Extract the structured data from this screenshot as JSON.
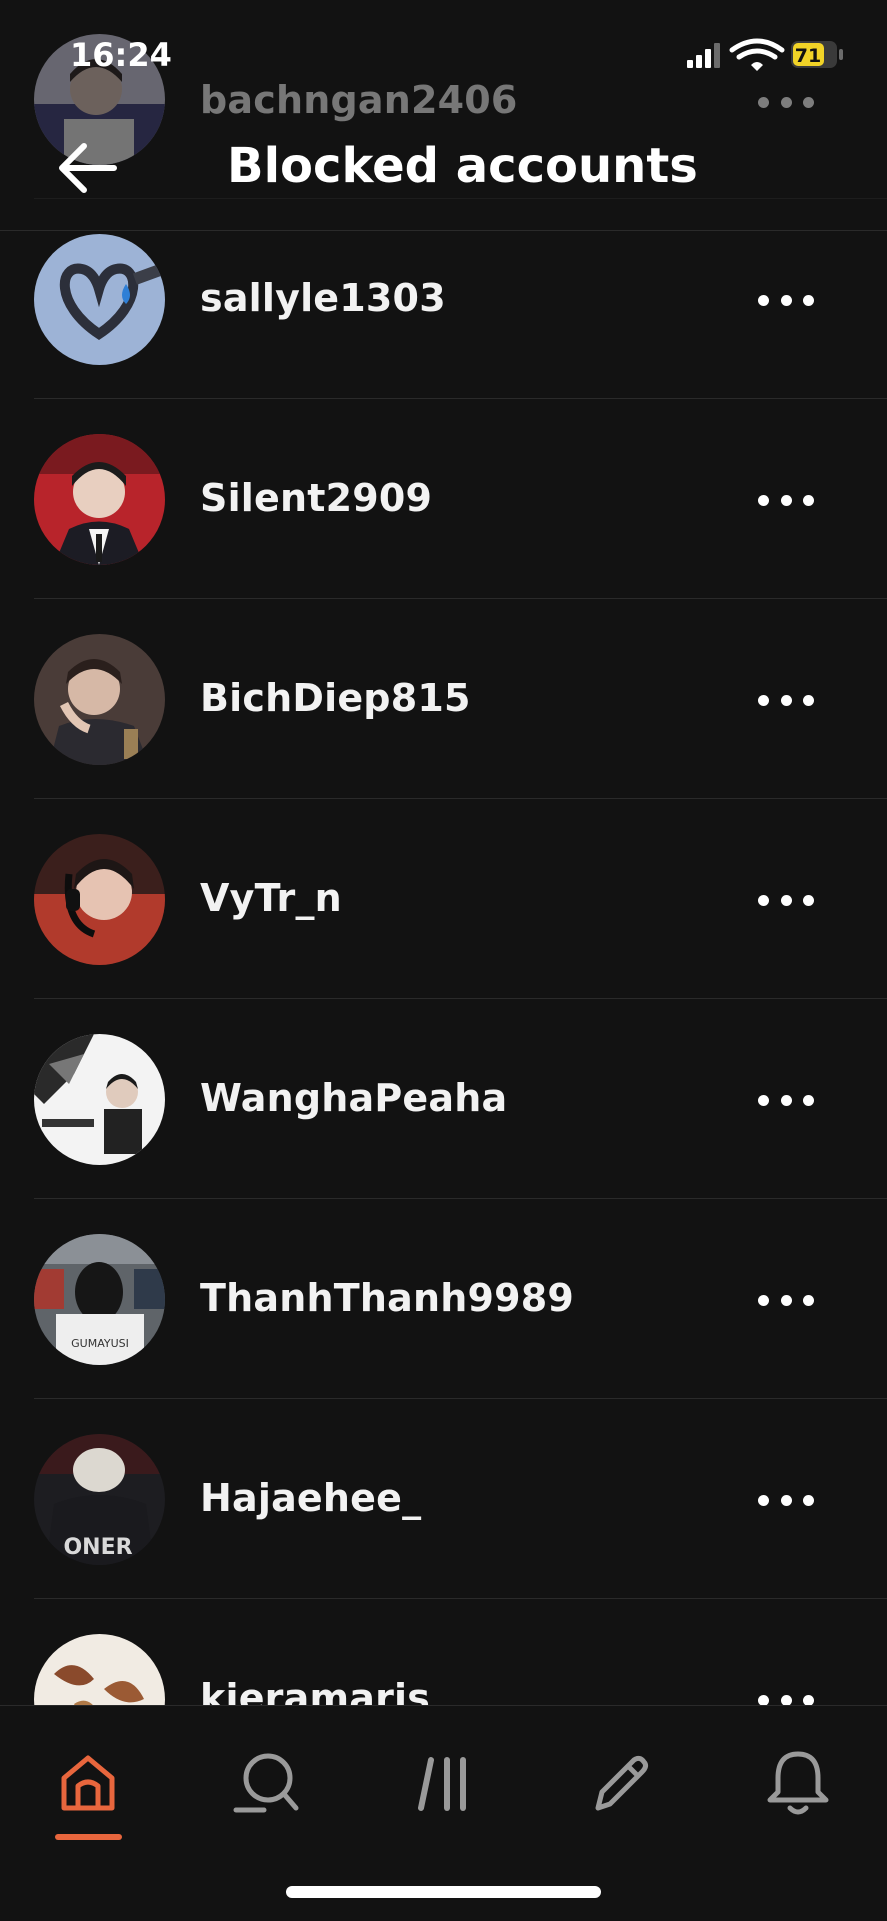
{
  "status_bar": {
    "time": "16:24",
    "battery": "71"
  },
  "header": {
    "title": "Blocked accounts",
    "back_icon": "arrow-left-icon"
  },
  "accounts": [
    {
      "username": "bachngan2406",
      "avatar_color": "#c9c7df"
    },
    {
      "username": "sallyle1303",
      "avatar_color": "#8aa3c8"
    },
    {
      "username": "Silent2909",
      "avatar_color": "#b3262c"
    },
    {
      "username": "BichDiep815",
      "avatar_color": "#5a4a44"
    },
    {
      "username": "VyTr_n",
      "avatar_color": "#6e2a22"
    },
    {
      "username": "WanghaPeaha",
      "avatar_color": "#e8e8e8"
    },
    {
      "username": "ThanhThanh9989",
      "avatar_color": "#6b6f74"
    },
    {
      "username": "Hajaehee_",
      "avatar_color": "#222226"
    },
    {
      "username": "kieramaris",
      "avatar_color": "#efe6dc"
    }
  ],
  "avatar_text": {
    "hajaehee": "ONER",
    "thanhthanh": "GUMAYUSI"
  },
  "bottom_nav": {
    "items": [
      "home-icon",
      "search-icon",
      "feed-icon",
      "compose-icon",
      "notifications-icon"
    ],
    "active": "home-icon",
    "accent": "#e8663d"
  }
}
